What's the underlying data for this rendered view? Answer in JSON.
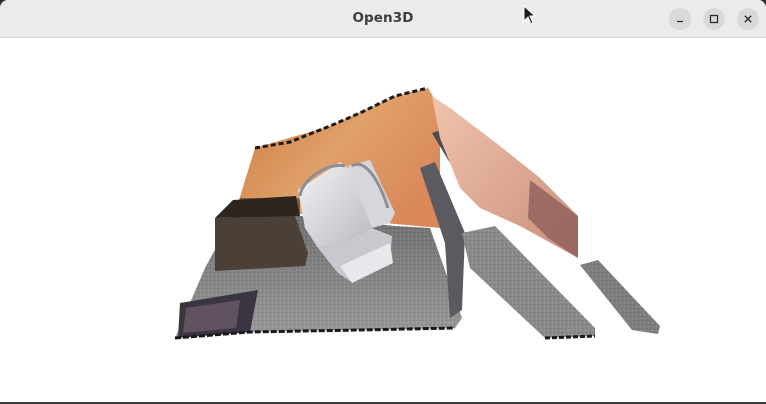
{
  "window": {
    "title": "Open3D"
  },
  "titlebar": {
    "buttons": [
      {
        "name": "minimize-button",
        "icon": "minimize-icon"
      },
      {
        "name": "maximize-button",
        "icon": "maximize-icon"
      },
      {
        "name": "close-button",
        "icon": "close-icon"
      }
    ]
  },
  "viewport": {
    "content": "3d-point-cloud-render",
    "colors": {
      "background": "#ffffff",
      "wall": "#d88a52",
      "floor": "#8f8f8f",
      "chair": "#e6e6ea",
      "side_wall": "#d89a84"
    }
  },
  "pointer": {
    "icon": "mouse-pointer-icon"
  }
}
